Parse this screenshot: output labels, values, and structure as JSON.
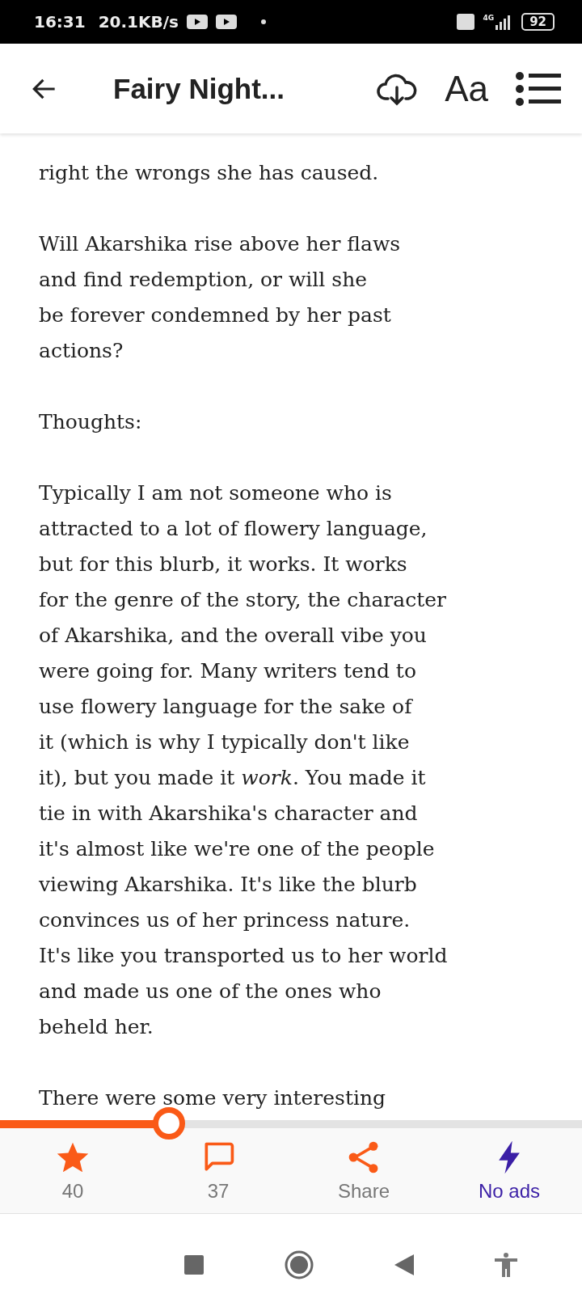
{
  "status_bar": {
    "time": "16:31",
    "speed": "20.1KB/s",
    "network": "4G",
    "battery": "92"
  },
  "header": {
    "title": "Fairy Night...",
    "text_button": "Aa"
  },
  "paragraphs": [
    {
      "lines": [
        "right the wrongs she has caused."
      ]
    },
    {
      "lines": [
        "Will Akarshika rise above her flaws",
        "and find redemption, or will she",
        "be forever condemned by her past",
        "actions?"
      ]
    },
    {
      "lines": [
        "Thoughts:"
      ]
    },
    {
      "lines": [
        "Typically I am not someone who is",
        "attracted to a lot of flowery language,",
        "but for this blurb, it works. It works",
        "for the genre of the story, the character",
        "of Akarshika, and the overall vibe you",
        "were going for. Many writers tend to",
        "use flowery language for the sake of",
        "it (which is why I typically don't like",
        "it), but you made it *work*. You made it",
        "tie in with Akarshika's character and",
        "it's almost like we're one of the people",
        "viewing Akarshika. It's like the blurb",
        "convinces us of her princess nature.",
        "It's like you transported us to her world",
        "and made us one of the ones who",
        "beheld her."
      ]
    },
    {
      "lines": [
        "There were some very interesting"
      ]
    }
  ],
  "progress": {
    "level": 0.29
  },
  "actions": [
    {
      "kind": "star",
      "label": "40"
    },
    {
      "kind": "comment",
      "label": "37"
    },
    {
      "kind": "share",
      "label": "Share"
    },
    {
      "kind": "premium",
      "label": "No ads"
    }
  ]
}
